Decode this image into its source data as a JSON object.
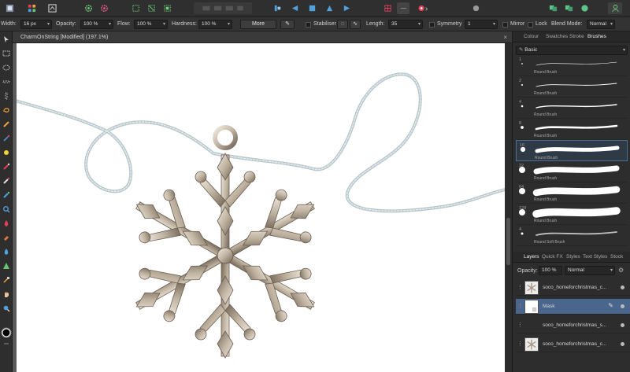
{
  "context_toolbar": {
    "width_label": "Width:",
    "width_value": "16 px",
    "opacity_label": "Opacity:",
    "opacity_value": "100 %",
    "flow_label": "Flow:",
    "flow_value": "100 %",
    "hardness_label": "Hardness:",
    "hardness_value": "100 %",
    "more_label": "More",
    "stabiliser_label": "Stabiliser",
    "length_label": "Length:",
    "length_value": "35",
    "symmetry_label": "Symmetry",
    "symmetry_value": "1",
    "mirror_label": "Mirror",
    "lock_label": "Lock",
    "blend_mode_label": "Blend Mode:",
    "blend_mode_value": "Normal"
  },
  "document": {
    "tab_title": "CharmOnString [Modified] (197.1%)",
    "close_glyph": "×"
  },
  "brushes_panel": {
    "tabs": [
      "Colour",
      "Swatches",
      "Stroke",
      "Brushes"
    ],
    "active_tab": "Brushes",
    "category": "Basic",
    "brushes": [
      {
        "size": "1",
        "name": "Round Brush"
      },
      {
        "size": "2",
        "name": "Round Brush"
      },
      {
        "size": "4",
        "name": "Round Brush"
      },
      {
        "size": "8",
        "name": "Round Brush"
      },
      {
        "size": "16",
        "name": "Round Brush",
        "selected": true
      },
      {
        "size": "32",
        "name": "Round Brush"
      },
      {
        "size": "64",
        "name": "Round Brush"
      },
      {
        "size": "128",
        "name": "Round Brush"
      },
      {
        "size": "4",
        "name": "Round Soft Brush"
      }
    ]
  },
  "layers_panel": {
    "tabs": [
      "Layers",
      "Quick FX",
      "Styles",
      "Text Styles",
      "Stock"
    ],
    "active_tab": "Layers",
    "opacity_label": "Opacity:",
    "opacity_value": "100 %",
    "blend_value": "Normal",
    "layers": [
      {
        "name": "soco_homeforchristmas_c...",
        "thumb": "snowflake"
      },
      {
        "name": "Mask",
        "thumb": "mask",
        "selected": true
      },
      {
        "name": "soco_homeforchristmas_s...",
        "thumb": "none"
      },
      {
        "name": "soco_homeforchristmas_c...",
        "thumb": "snowflake"
      }
    ]
  },
  "colors": {
    "accent": "#4a668c",
    "canvas": "#ffffff",
    "string": "#c5d3d7",
    "charm": "#bfb2a0"
  }
}
